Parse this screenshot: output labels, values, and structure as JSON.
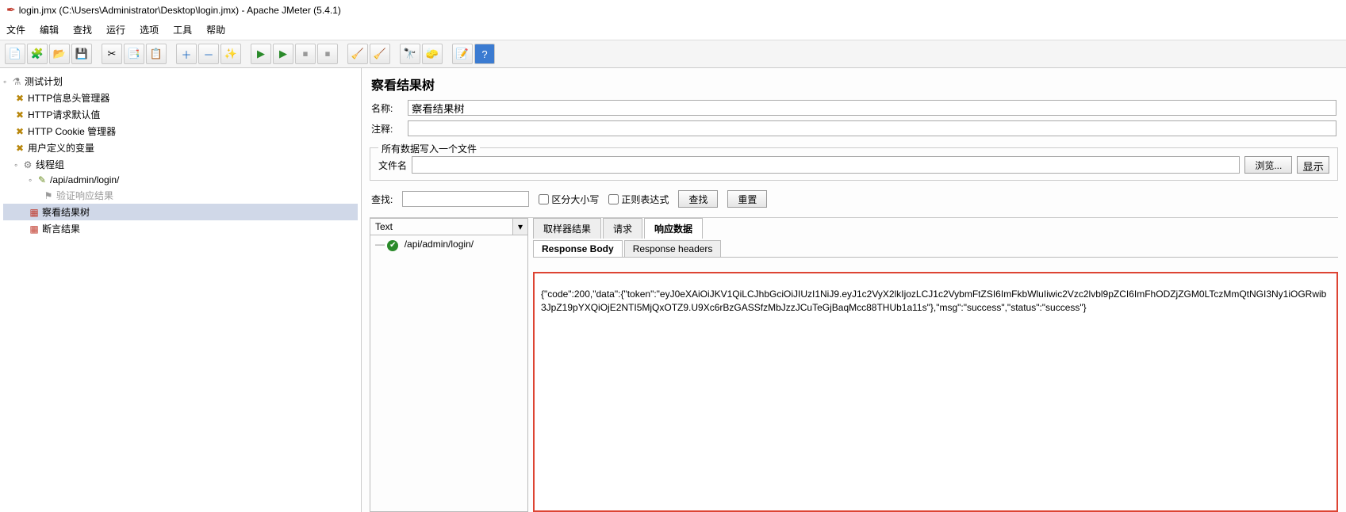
{
  "title": "login.jmx (C:\\Users\\Administrator\\Desktop\\login.jmx) - Apache JMeter (5.4.1)",
  "menu": [
    "文件",
    "编辑",
    "查找",
    "运行",
    "选项",
    "工具",
    "帮助"
  ],
  "tree": {
    "root": "测试计划",
    "items": [
      "HTTP信息头管理器",
      "HTTP请求默认值",
      "HTTP Cookie 管理器",
      "用户定义的变量"
    ],
    "thread_group": "线程组",
    "sampler": "/api/admin/login/",
    "assertion": "验证响应结果",
    "view_results": "察看结果树",
    "assert_results": "断言结果"
  },
  "panel": {
    "heading": "察看结果树",
    "name_label": "名称:",
    "name_value": "察看结果树",
    "comment_label": "注释:",
    "comment_value": "",
    "group_title": "所有数据写入一个文件",
    "filename_label": "文件名",
    "filename_value": "",
    "browse": "浏览...",
    "show": "显示",
    "search_label": "查找:",
    "search_value": "",
    "case_label": "区分大小写",
    "regex_label": "正则表达式",
    "search_btn": "查找",
    "reset_btn": "重置"
  },
  "results": {
    "format": "Text",
    "sample_name": "/api/admin/login/",
    "tabs": [
      "取样器结果",
      "请求",
      "响应数据"
    ],
    "subtabs": [
      "Response Body",
      "Response headers"
    ],
    "body": "{\"code\":200,\"data\":{\"token\":\"eyJ0eXAiOiJKV1QiLCJhbGciOiJIUzI1NiJ9.eyJ1c2VyX2lkIjozLCJ1c2VybmFtZSI6ImFkbWluIiwic2Vzc2lvbl9pZCI6ImFhODZjZGM0LTczMmQtNGI3Ny1iOGRwib3JpZ19pYXQiOjE2NTI5MjQxOTZ9.U9Xc6rBzGASSfzMbJzzJCuTeGjBaqMcc88THUb1a11s\"},\"msg\":\"success\",\"status\":\"success\"}"
  }
}
